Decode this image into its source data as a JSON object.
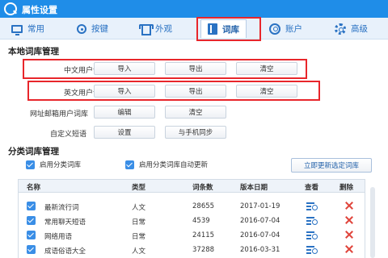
{
  "window": {
    "title": "属性设置"
  },
  "tabs": [
    {
      "label": "常用",
      "icon": "monitor-icon"
    },
    {
      "label": "按键",
      "icon": "key-icon"
    },
    {
      "label": "外观",
      "icon": "shirt-icon"
    },
    {
      "label": "词库",
      "icon": "book-icon",
      "active": true
    },
    {
      "label": "账户",
      "icon": "user-icon"
    },
    {
      "label": "高级",
      "icon": "gear-icon"
    }
  ],
  "local": {
    "title": "本地词库管理",
    "rows": [
      {
        "label": "中文用户词库",
        "buttons": [
          "导入",
          "导出",
          "清空"
        ]
      },
      {
        "label": "英文用户词库",
        "buttons": [
          "导入",
          "导出",
          "清空"
        ]
      },
      {
        "label": "网址邮箱用户词库",
        "buttons": [
          "编辑",
          "清空"
        ]
      },
      {
        "label": "自定义短语",
        "buttons": [
          "设置",
          "与手机同步"
        ]
      }
    ]
  },
  "category": {
    "title": "分类词库管理",
    "enable_label": "启用分类词库",
    "auto_update_label": "启用分类词库自动更新",
    "update_button": "立即更新选定词库"
  },
  "table": {
    "headers": [
      "名称",
      "类型",
      "词条数",
      "版本日期",
      "查看",
      "删除"
    ],
    "rows": [
      {
        "name": "最新流行词",
        "type": "人文",
        "count": "28655",
        "date": "2017-01-19"
      },
      {
        "name": "常用聊天短语",
        "type": "日常",
        "count": "4539",
        "date": "2016-07-04"
      },
      {
        "name": "网络用语",
        "type": "日常",
        "count": "24115",
        "date": "2016-07-04"
      },
      {
        "name": "成语俗语大全",
        "type": "人文",
        "count": "37288",
        "date": "2016-03-31"
      }
    ]
  },
  "colors": {
    "accent": "#1f8de8",
    "highlight": "#e8262b",
    "delete": "#e0453c"
  }
}
